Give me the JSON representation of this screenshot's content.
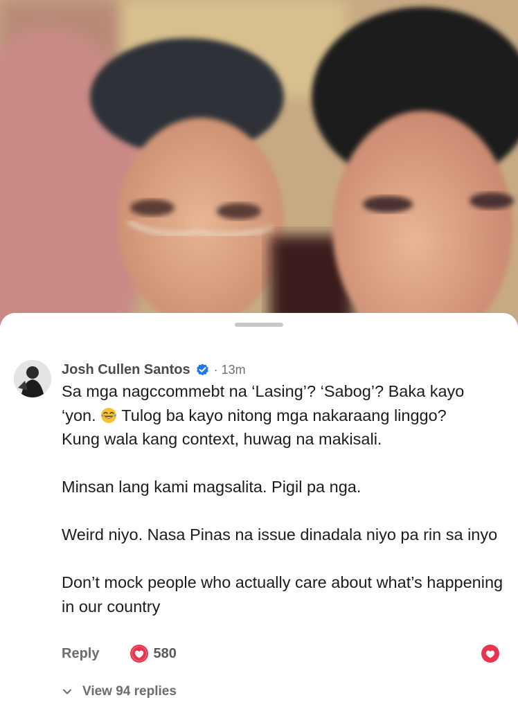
{
  "comment": {
    "author": "Josh Cullen Santos",
    "verified_icon": "verified-badge-icon",
    "timestamp": "· 13m",
    "paragraphs": [
      {
        "line1": "Sa mga nagccommebt na ‘Lasing’? ‘Sabog’? Baka kayo",
        "before_emoji": "‘yon. ",
        "emoji": "tears-of-joy-emoji",
        "after_emoji": " Tulog ba kayo nitong mga nakaraang linggo?",
        "line3": "Kung wala kang context, huwag na makisali."
      },
      {
        "text": "Minsan lang kami magsalita. Pigil pa nga."
      },
      {
        "text": "Weird niyo. Nasa Pinas na issue dinadala niyo pa rin sa inyo"
      },
      {
        "text": "Don’t mock people who actually care about what’s happening in our country"
      }
    ],
    "reply_label": "Reply",
    "like_icon": "heart-icon",
    "like_count": "580",
    "view_replies_label": "View 94 replies"
  },
  "colors": {
    "heart": "#e8344f",
    "verified": "#1877f2",
    "sheet": "#ffffff"
  }
}
